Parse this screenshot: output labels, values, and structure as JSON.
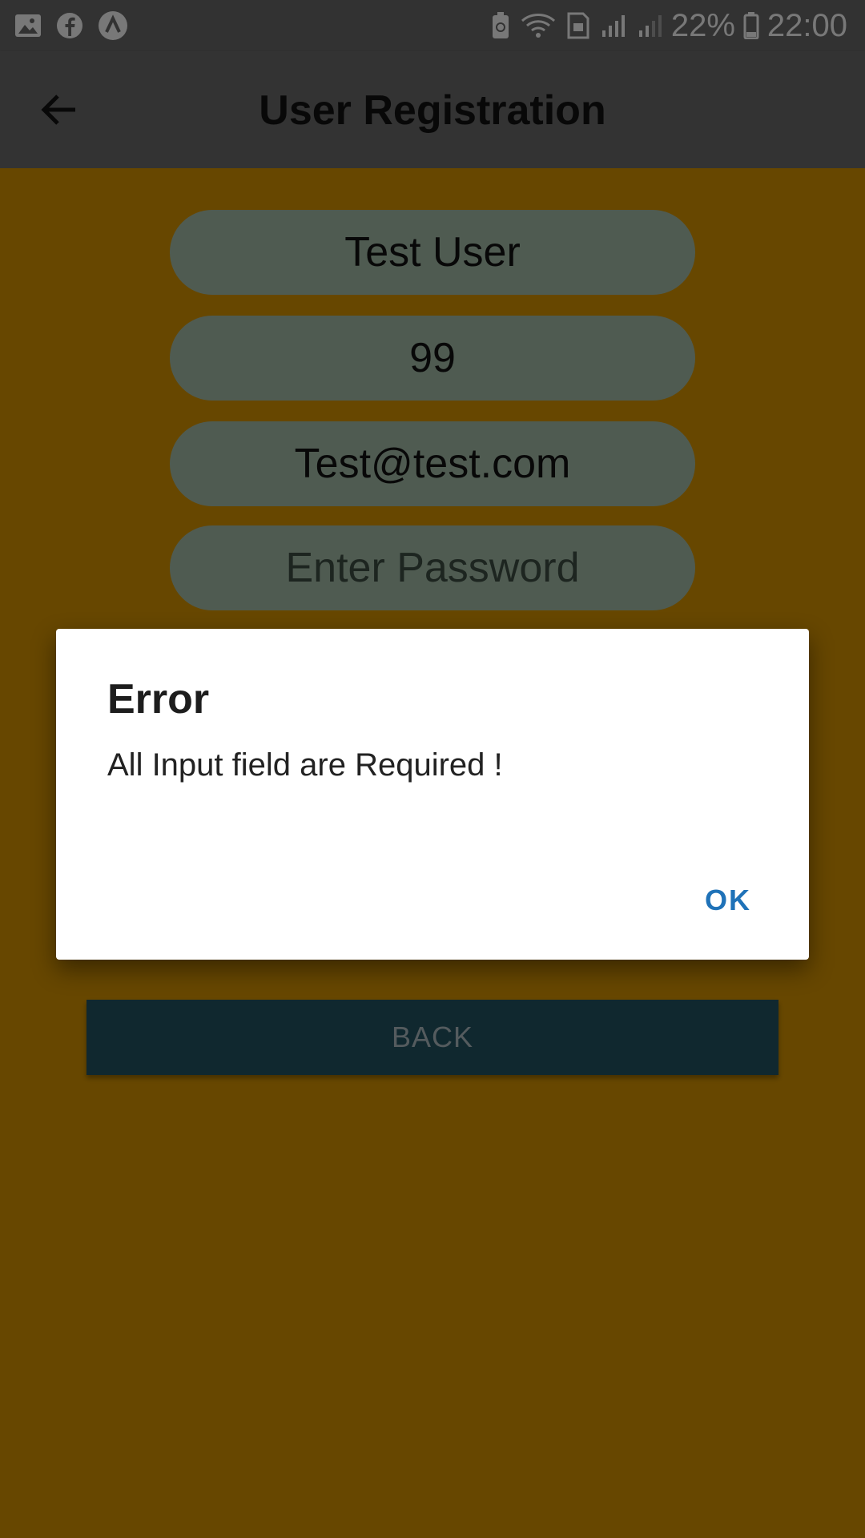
{
  "status_bar": {
    "left_icons": [
      "gallery-icon",
      "facebook-icon",
      "app-icon"
    ],
    "right_icons": [
      "battery-saver-icon",
      "wifi-icon",
      "sim-icon",
      "signal-icon",
      "signal-icon-2"
    ],
    "battery_percent": "22%",
    "time": "22:00"
  },
  "app_bar": {
    "title": "User Registration"
  },
  "form": {
    "name_value": "Test User",
    "age_value": "99",
    "email_value": "Test@test.com",
    "password_placeholder": "Enter Password",
    "back_label": "BACK"
  },
  "dialog": {
    "title": "Error",
    "message": "All Input field are Required !",
    "ok_label": "OK"
  },
  "colors": {
    "background": "#cf8f00",
    "field": "#9fb6a3",
    "button": "#20515f",
    "accent": "#1f72b8"
  }
}
